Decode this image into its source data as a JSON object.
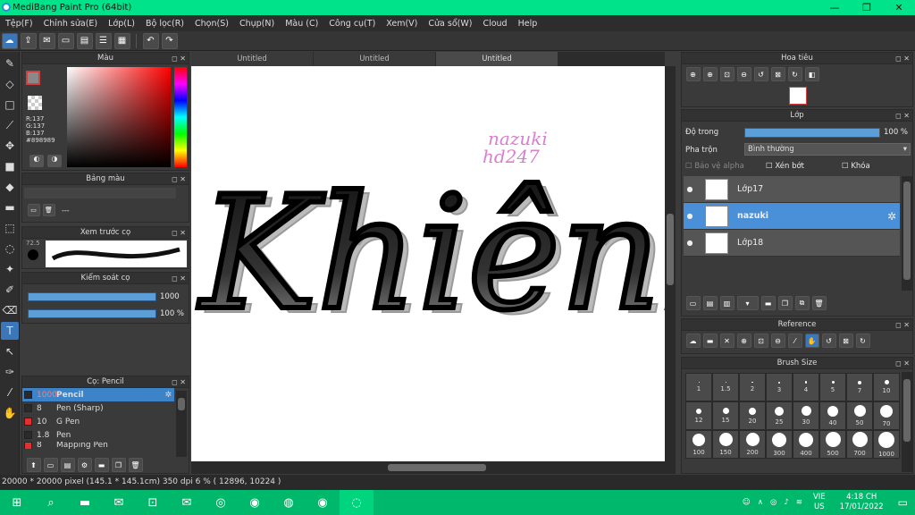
{
  "app": {
    "title": "MediBang Paint Pro (64bit)"
  },
  "menu": [
    "Tệp(F)",
    "Chỉnh sửa(E)",
    "Lớp(L)",
    "Bộ lọc(R)",
    "Chọn(S)",
    "Chụp(N)",
    "Màu (C)",
    "Công cụ(T)",
    "Xem(V)",
    "Cửa sổ(W)",
    "Cloud",
    "Help"
  ],
  "tabs": [
    "Untitled",
    "Untitled",
    "Untitled"
  ],
  "color_panel": {
    "title": "Màu",
    "r": "R:137",
    "g": "G:137",
    "b": "B:137",
    "hex": "#898989",
    "fg": "#898989",
    "accent": "#d04040"
  },
  "palette_panel": {
    "title": "Bảng màu",
    "dash": "---"
  },
  "preview_panel": {
    "title": "Xem trước cọ",
    "size": "72.5"
  },
  "brush_control": {
    "title": "Kiểm soát cọ",
    "size_value": "1000",
    "opacity_value": "100 %"
  },
  "brush_list": {
    "title": "Cọ: Pencil",
    "items": [
      {
        "size": "1000",
        "name": "Pencil",
        "color": "#2a2a2a"
      },
      {
        "size": "8",
        "name": "Pen (Sharp)",
        "color": "#2a2a2a"
      },
      {
        "size": "10",
        "name": "G Pen",
        "color": "#e03030"
      },
      {
        "size": "1.8",
        "name": "Pen",
        "color": "#2a2a2a"
      },
      {
        "size": "8",
        "name": "Mapping Pen",
        "color": "#e03030"
      }
    ]
  },
  "navigator": {
    "title": "Hoa tiêu"
  },
  "layer_panel": {
    "title": "Lớp",
    "opacity_label": "Độ trong",
    "opacity_value": "100 %",
    "opacity_fraction": 1.0,
    "blend_label": "Pha trộn",
    "blend_value": "Bình thường",
    "protect_alpha": "Bảo vệ alpha",
    "clipping": "Xén bớt",
    "lock": "Khóa",
    "layers": [
      {
        "name": "Lớp17"
      },
      {
        "name": "nazuki"
      },
      {
        "name": "Lớp18"
      }
    ]
  },
  "reference_panel": {
    "title": "Reference"
  },
  "brush_size_panel": {
    "title": "Brush Size",
    "sizes": [
      "1",
      "1.5",
      "2",
      "3",
      "4",
      "5",
      "7",
      "10",
      "12",
      "15",
      "20",
      "25",
      "30",
      "40",
      "50",
      "70",
      "100",
      "150",
      "200",
      "300",
      "400",
      "500",
      "700",
      "1000"
    ]
  },
  "canvas": {
    "text_main": "Khiênk",
    "watermark_line1": "nazuki",
    "watermark_line2": "hd247",
    "watermark_color": "#d97fd0"
  },
  "status": {
    "text": "20000 * 20000 pixel   (145.1 * 145.1cm)   350 dpi   6 %   ( 12896, 10224 )"
  },
  "taskbar": {
    "lang_top": "VIE",
    "lang_bottom": "US",
    "time": "4:18 CH",
    "date": "17/01/2022"
  }
}
